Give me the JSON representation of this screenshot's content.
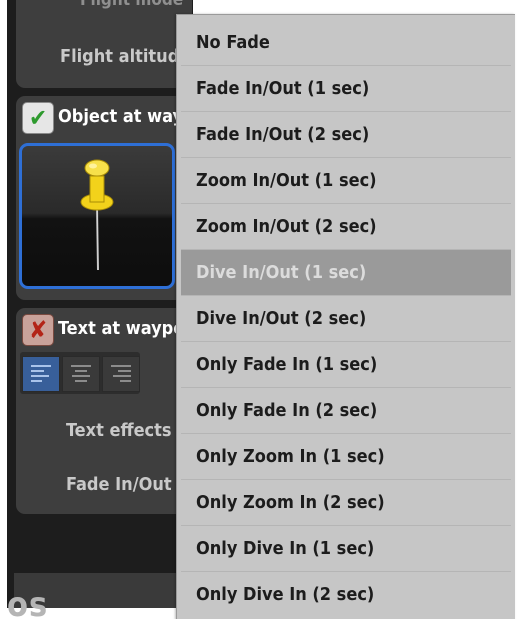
{
  "panel": {
    "cut_top_label": "Flight mode",
    "flight_altitude_label": "Flight altitude",
    "object_section_label": "Object at way",
    "text_section_label": "Text at waypo",
    "text_effects_label": "Text effects",
    "fade_label": "Fade In/Out",
    "bottom_cut_text": "os"
  },
  "dropdown": {
    "selected_index": 5,
    "options": [
      "No Fade",
      "Fade In/Out (1 sec)",
      "Fade In/Out (2 sec)",
      "Zoom In/Out (1 sec)",
      "Zoom In/Out (2 sec)",
      "Dive In/Out (1 sec)",
      "Dive In/Out (2 sec)",
      "Only Fade In (1 sec)",
      "Only Fade In (2 sec)",
      "Only Zoom In (1 sec)",
      "Only Zoom In (2 sec)",
      "Only Dive In (1 sec)",
      "Only Dive In (2 sec)"
    ]
  },
  "icons": {
    "object_checkbox": "check-icon",
    "text_checkbox": "cross-icon",
    "preview": "pushpin-icon",
    "align": [
      "align-left-icon",
      "align-center-icon",
      "align-right-icon"
    ]
  },
  "colors": {
    "accent_blue": "#2e6fd6",
    "pin_yellow": "#f2d21b",
    "menu_bg": "#c6c6c6",
    "menu_highlight": "#9a9a9a"
  }
}
